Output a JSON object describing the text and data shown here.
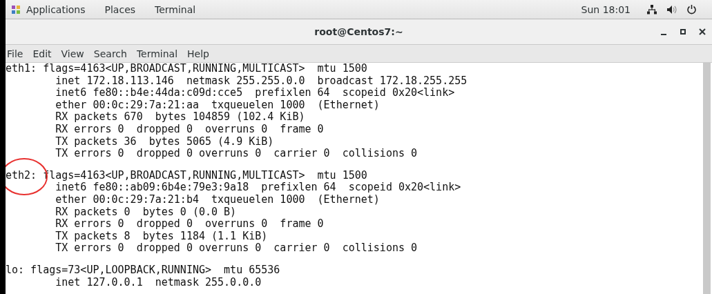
{
  "top_bar": {
    "menus": [
      "Applications",
      "Places",
      "Terminal"
    ],
    "clock": "Sun 18:01"
  },
  "window": {
    "title": "root@Centos7:~"
  },
  "menu_bar": [
    "File",
    "Edit",
    "View",
    "Search",
    "Terminal",
    "Help"
  ],
  "terminal_blocks": [
    {
      "circled": false,
      "lines": [
        "eth1: flags=4163<UP,BROADCAST,RUNNING,MULTICAST>  mtu 1500",
        "        inet 172.18.113.146  netmask 255.255.0.0  broadcast 172.18.255.255",
        "        inet6 fe80::b4e:44da:c09d:cce5  prefixlen 64  scopeid 0x20<link>",
        "        ether 00:0c:29:7a:21:aa  txqueuelen 1000  (Ethernet)",
        "        RX packets 670  bytes 104859 (102.4 KiB)",
        "        RX errors 0  dropped 0  overruns 0  frame 0",
        "        TX packets 36  bytes 5065 (4.9 KiB)",
        "        TX errors 0  dropped 0 overruns 0  carrier 0  collisions 0"
      ]
    },
    {
      "circled": true,
      "lines": [
        "eth2: flags=4163<UP,BROADCAST,RUNNING,MULTICAST>  mtu 1500",
        "        inet6 fe80::ab09:6b4e:79e3:9a18  prefixlen 64  scopeid 0x20<link>",
        "        ether 00:0c:29:7a:21:b4  txqueuelen 1000  (Ethernet)",
        "        RX packets 0  bytes 0 (0.0 B)",
        "        RX errors 0  dropped 0  overruns 0  frame 0",
        "        TX packets 8  bytes 1184 (1.1 KiB)",
        "        TX errors 0  dropped 0 overruns 0  carrier 0  collisions 0"
      ]
    },
    {
      "circled": false,
      "lines": [
        "lo: flags=73<UP,LOOPBACK,RUNNING>  mtu 65536",
        "        inet 127.0.0.1  netmask 255.0.0.0"
      ]
    }
  ]
}
